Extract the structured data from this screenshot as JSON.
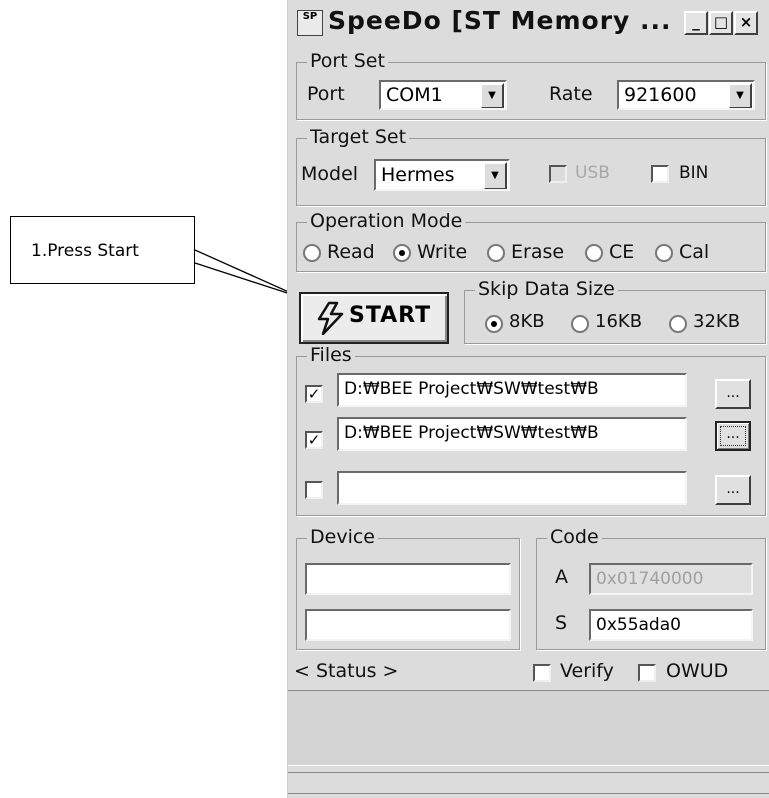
{
  "callout": {
    "text": "1.Press Start"
  },
  "window": {
    "title": "SpeeDo [ST Memory ...",
    "icon_text": "SP",
    "buttons": {
      "minimize": "_",
      "maximize": "□",
      "close": "×"
    }
  },
  "port_set": {
    "legend": "Port Set",
    "port_label": "Port",
    "port_value": "COM1",
    "rate_label": "Rate",
    "rate_value": "921600"
  },
  "target_set": {
    "legend": "Target Set",
    "model_label": "Model",
    "model_value": "Hermes",
    "usb_label": "USB",
    "usb_checked": false,
    "bin_label": "BIN",
    "bin_checked": false
  },
  "operation_mode": {
    "legend": "Operation Mode",
    "options": [
      {
        "label": "Read",
        "selected": false
      },
      {
        "label": "Write",
        "selected": true
      },
      {
        "label": "Erase",
        "selected": false
      },
      {
        "label": "CE",
        "selected": false
      },
      {
        "label": "Cal",
        "selected": false
      }
    ]
  },
  "start_button": {
    "label": "START"
  },
  "skip_data_size": {
    "legend": "Skip Data Size",
    "options": [
      {
        "label": "8KB",
        "selected": true
      },
      {
        "label": "16KB",
        "selected": false
      },
      {
        "label": "32KB",
        "selected": false
      }
    ]
  },
  "files": {
    "legend": "Files",
    "rows": [
      {
        "checked": true,
        "path": "D:₩BEE Project₩SW₩test₩B",
        "browse": "..."
      },
      {
        "checked": true,
        "path": "D:₩BEE Project₩SW₩test₩B",
        "browse": "..."
      },
      {
        "checked": false,
        "path": "",
        "browse": "..."
      }
    ]
  },
  "device": {
    "legend": "Device",
    "field1": "",
    "field2": ""
  },
  "code": {
    "legend": "Code",
    "a_label": "A",
    "a_value": "0x01740000",
    "s_label": "S",
    "s_value": "0x55ada0"
  },
  "status": {
    "label": "< Status >",
    "verify_label": "Verify",
    "verify_checked": false,
    "owud_label": "OWUD",
    "owud_checked": false
  },
  "colors": {
    "window_bg": "#dcdcdc",
    "field_bg": "#ffffff",
    "status_bg": "#d4d4d4"
  }
}
